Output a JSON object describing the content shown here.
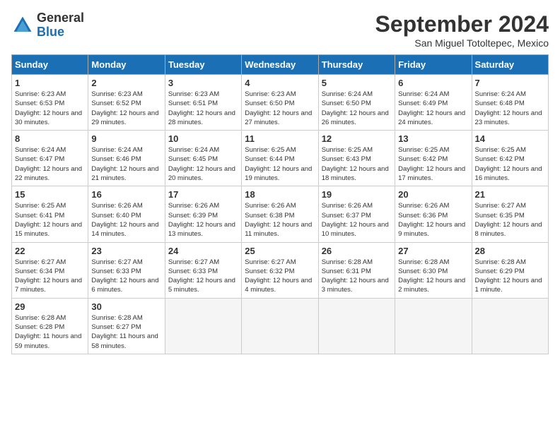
{
  "logo": {
    "general": "General",
    "blue": "Blue"
  },
  "title": "September 2024",
  "location": "San Miguel Totoltepec, Mexico",
  "days_header": [
    "Sunday",
    "Monday",
    "Tuesday",
    "Wednesday",
    "Thursday",
    "Friday",
    "Saturday"
  ],
  "weeks": [
    [
      {
        "day": "1",
        "sunrise": "6:23 AM",
        "sunset": "6:53 PM",
        "daylight": "12 hours and 30 minutes."
      },
      {
        "day": "2",
        "sunrise": "6:23 AM",
        "sunset": "6:52 PM",
        "daylight": "12 hours and 29 minutes."
      },
      {
        "day": "3",
        "sunrise": "6:23 AM",
        "sunset": "6:51 PM",
        "daylight": "12 hours and 28 minutes."
      },
      {
        "day": "4",
        "sunrise": "6:23 AM",
        "sunset": "6:50 PM",
        "daylight": "12 hours and 27 minutes."
      },
      {
        "day": "5",
        "sunrise": "6:24 AM",
        "sunset": "6:50 PM",
        "daylight": "12 hours and 26 minutes."
      },
      {
        "day": "6",
        "sunrise": "6:24 AM",
        "sunset": "6:49 PM",
        "daylight": "12 hours and 24 minutes."
      },
      {
        "day": "7",
        "sunrise": "6:24 AM",
        "sunset": "6:48 PM",
        "daylight": "12 hours and 23 minutes."
      }
    ],
    [
      {
        "day": "8",
        "sunrise": "6:24 AM",
        "sunset": "6:47 PM",
        "daylight": "12 hours and 22 minutes."
      },
      {
        "day": "9",
        "sunrise": "6:24 AM",
        "sunset": "6:46 PM",
        "daylight": "12 hours and 21 minutes."
      },
      {
        "day": "10",
        "sunrise": "6:24 AM",
        "sunset": "6:45 PM",
        "daylight": "12 hours and 20 minutes."
      },
      {
        "day": "11",
        "sunrise": "6:25 AM",
        "sunset": "6:44 PM",
        "daylight": "12 hours and 19 minutes."
      },
      {
        "day": "12",
        "sunrise": "6:25 AM",
        "sunset": "6:43 PM",
        "daylight": "12 hours and 18 minutes."
      },
      {
        "day": "13",
        "sunrise": "6:25 AM",
        "sunset": "6:42 PM",
        "daylight": "12 hours and 17 minutes."
      },
      {
        "day": "14",
        "sunrise": "6:25 AM",
        "sunset": "6:42 PM",
        "daylight": "12 hours and 16 minutes."
      }
    ],
    [
      {
        "day": "15",
        "sunrise": "6:25 AM",
        "sunset": "6:41 PM",
        "daylight": "12 hours and 15 minutes."
      },
      {
        "day": "16",
        "sunrise": "6:26 AM",
        "sunset": "6:40 PM",
        "daylight": "12 hours and 14 minutes."
      },
      {
        "day": "17",
        "sunrise": "6:26 AM",
        "sunset": "6:39 PM",
        "daylight": "12 hours and 13 minutes."
      },
      {
        "day": "18",
        "sunrise": "6:26 AM",
        "sunset": "6:38 PM",
        "daylight": "12 hours and 11 minutes."
      },
      {
        "day": "19",
        "sunrise": "6:26 AM",
        "sunset": "6:37 PM",
        "daylight": "12 hours and 10 minutes."
      },
      {
        "day": "20",
        "sunrise": "6:26 AM",
        "sunset": "6:36 PM",
        "daylight": "12 hours and 9 minutes."
      },
      {
        "day": "21",
        "sunrise": "6:27 AM",
        "sunset": "6:35 PM",
        "daylight": "12 hours and 8 minutes."
      }
    ],
    [
      {
        "day": "22",
        "sunrise": "6:27 AM",
        "sunset": "6:34 PM",
        "daylight": "12 hours and 7 minutes."
      },
      {
        "day": "23",
        "sunrise": "6:27 AM",
        "sunset": "6:33 PM",
        "daylight": "12 hours and 6 minutes."
      },
      {
        "day": "24",
        "sunrise": "6:27 AM",
        "sunset": "6:33 PM",
        "daylight": "12 hours and 5 minutes."
      },
      {
        "day": "25",
        "sunrise": "6:27 AM",
        "sunset": "6:32 PM",
        "daylight": "12 hours and 4 minutes."
      },
      {
        "day": "26",
        "sunrise": "6:28 AM",
        "sunset": "6:31 PM",
        "daylight": "12 hours and 3 minutes."
      },
      {
        "day": "27",
        "sunrise": "6:28 AM",
        "sunset": "6:30 PM",
        "daylight": "12 hours and 2 minutes."
      },
      {
        "day": "28",
        "sunrise": "6:28 AM",
        "sunset": "6:29 PM",
        "daylight": "12 hours and 1 minute."
      }
    ],
    [
      {
        "day": "29",
        "sunrise": "6:28 AM",
        "sunset": "6:28 PM",
        "daylight": "11 hours and 59 minutes."
      },
      {
        "day": "30",
        "sunrise": "6:28 AM",
        "sunset": "6:27 PM",
        "daylight": "11 hours and 58 minutes."
      },
      null,
      null,
      null,
      null,
      null
    ]
  ]
}
